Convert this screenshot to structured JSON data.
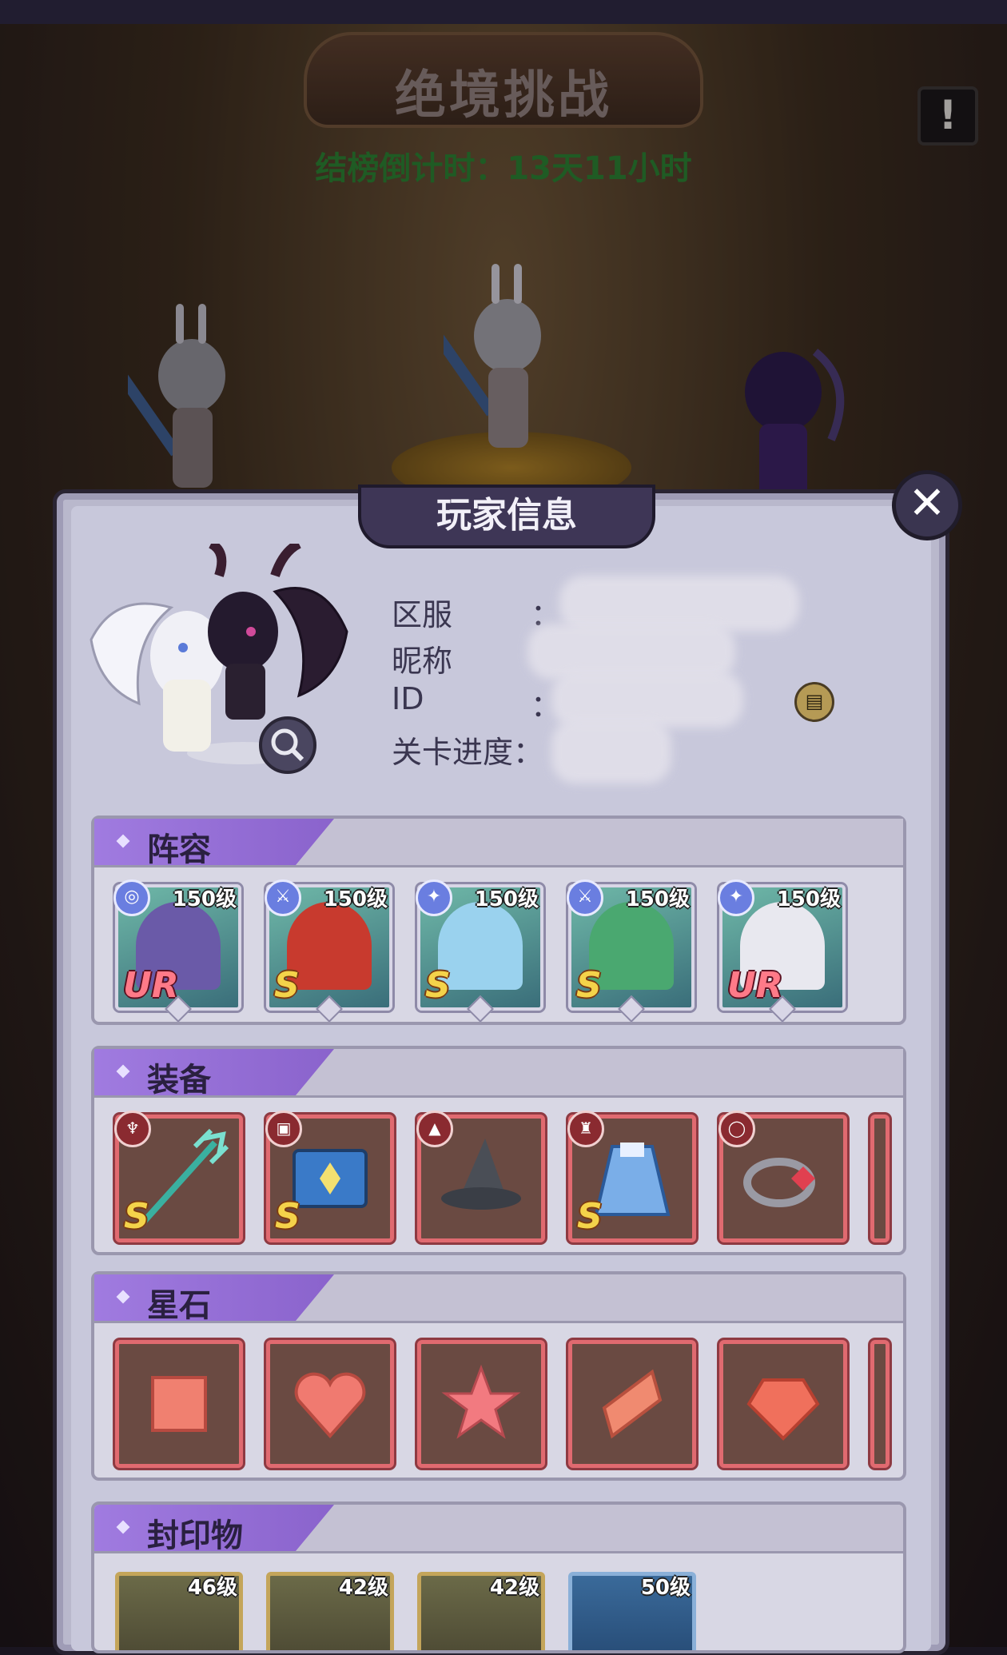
{
  "header": {
    "title": "绝境挑战",
    "countdown": "结榜倒计时：13天11小时",
    "alert_icon": "exclamation-icon"
  },
  "panel": {
    "title": "玩家信息",
    "close_glyph": "✕"
  },
  "player": {
    "labels": {
      "server": "区服",
      "nickname": "昵称",
      "id": "ID",
      "progress": "关卡进度："
    },
    "colon": "：",
    "copy_icon": "copy-icon"
  },
  "sections": {
    "lineup": {
      "title": "阵容",
      "heroes": [
        {
          "level": "150级",
          "rank": "UR",
          "type": "swirl-icon",
          "palette": "#6a5aa8"
        },
        {
          "level": "150级",
          "rank": "S",
          "type": "sword-icon",
          "palette": "#c83a2e"
        },
        {
          "level": "150级",
          "rank": "S",
          "type": "wing-icon",
          "palette": "#9ad2ee"
        },
        {
          "level": "150级",
          "rank": "S",
          "type": "sword-icon",
          "palette": "#4aa870"
        },
        {
          "level": "150级",
          "rank": "UR",
          "type": "wing-icon",
          "palette": "#e8e8ef"
        }
      ]
    },
    "equipment": {
      "title": "装备",
      "items": [
        {
          "name": "trident-icon",
          "rank": "S",
          "slot": "weapon-slot-icon"
        },
        {
          "name": "spellbook-icon",
          "rank": "S",
          "slot": "book-slot-icon"
        },
        {
          "name": "witch-hat-icon",
          "rank": "",
          "slot": "hat-slot-icon"
        },
        {
          "name": "cloak-icon",
          "rank": "S",
          "slot": "armor-slot-icon"
        },
        {
          "name": "ring-icon",
          "rank": "",
          "slot": "ring-slot-icon"
        }
      ]
    },
    "starstones": {
      "title": "星石",
      "items": [
        {
          "name": "square-gem-icon"
        },
        {
          "name": "heart-gem-icon"
        },
        {
          "name": "star-gem-icon"
        },
        {
          "name": "rhombus-gem-icon"
        },
        {
          "name": "round-gem-icon"
        }
      ]
    },
    "seals": {
      "title": "封印物",
      "items": [
        {
          "level": "46级"
        },
        {
          "level": "42级"
        },
        {
          "level": "42级"
        },
        {
          "level": "50级"
        }
      ]
    }
  }
}
